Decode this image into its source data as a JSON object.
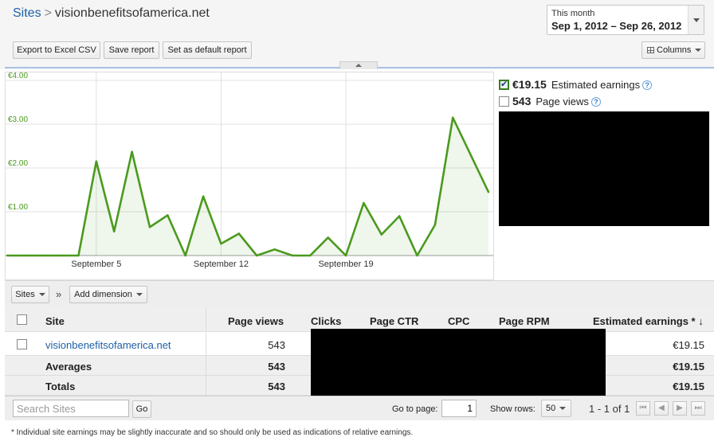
{
  "breadcrumb": {
    "root": "Sites",
    "separator": ">",
    "current": "visionbenefitsofamerica.net"
  },
  "date_range": {
    "label": "This month",
    "value": "Sep 1, 2012 – Sep 26, 2012"
  },
  "toolbar": {
    "export_label": "Export to Excel CSV",
    "save_label": "Save report",
    "default_label": "Set as default report",
    "columns_label": "Columns"
  },
  "legend": {
    "earnings_value": "€19.15",
    "earnings_name": "Estimated earnings",
    "earnings_checked": true,
    "pageviews_value": "543",
    "pageviews_name": "Page views",
    "pageviews_checked": false,
    "help_glyph": "?"
  },
  "chart_data": {
    "type": "area",
    "series": [
      {
        "name": "Estimated earnings",
        "color": "#4a9a1e",
        "values": [
          0,
          0,
          0,
          0,
          0,
          2.15,
          0.55,
          2.37,
          0.65,
          0.92,
          0,
          1.35,
          0.27,
          0.5,
          0,
          0.14,
          0,
          0,
          0.41,
          0,
          1.2,
          0.48,
          0.9,
          0,
          0.7,
          3.15,
          2.3,
          1.45
        ]
      }
    ],
    "x_ticks": [
      {
        "label": "September 5",
        "index": 5
      },
      {
        "label": "September 12",
        "index": 12
      },
      {
        "label": "September 19",
        "index": 19
      }
    ],
    "y_ticks": [
      {
        "label": "€1.00",
        "value": 1
      },
      {
        "label": "€2.00",
        "value": 2
      },
      {
        "label": "€3.00",
        "value": 3
      },
      {
        "label": "€4.00",
        "value": 4
      }
    ],
    "ylim": [
      0,
      4
    ],
    "grid": true
  },
  "dimension_bar": {
    "sites_label": "Sites",
    "arrow": "»",
    "add_dimension_label": "Add dimension"
  },
  "table": {
    "headers": {
      "site": "Site",
      "page_views": "Page views",
      "clicks": "Clicks",
      "page_ctr": "Page CTR",
      "cpc": "CPC",
      "page_rpm": "Page RPM",
      "earnings": "Estimated earnings * ↓"
    },
    "row": {
      "site": "visionbenefitsofamerica.net",
      "page_views": "543",
      "earnings": "€19.15"
    },
    "averages": {
      "label": "Averages",
      "page_views": "543",
      "earnings": "€19.15"
    },
    "totals": {
      "label": "Totals",
      "page_views": "543",
      "earnings": "€19.15"
    }
  },
  "footer": {
    "search_placeholder": "Search Sites",
    "go_label": "Go",
    "goto_label": "Go to page:",
    "page_value": "1",
    "show_rows_label": "Show rows:",
    "rows_value": "50",
    "range_text": "1 - 1 of 1",
    "nav_first": "⏮",
    "nav_prev": "◀",
    "nav_next": "▶",
    "nav_last": "⏭"
  },
  "footnote": "* Individual site earnings may be slightly inaccurate and so should only be used as indications of relative earnings."
}
